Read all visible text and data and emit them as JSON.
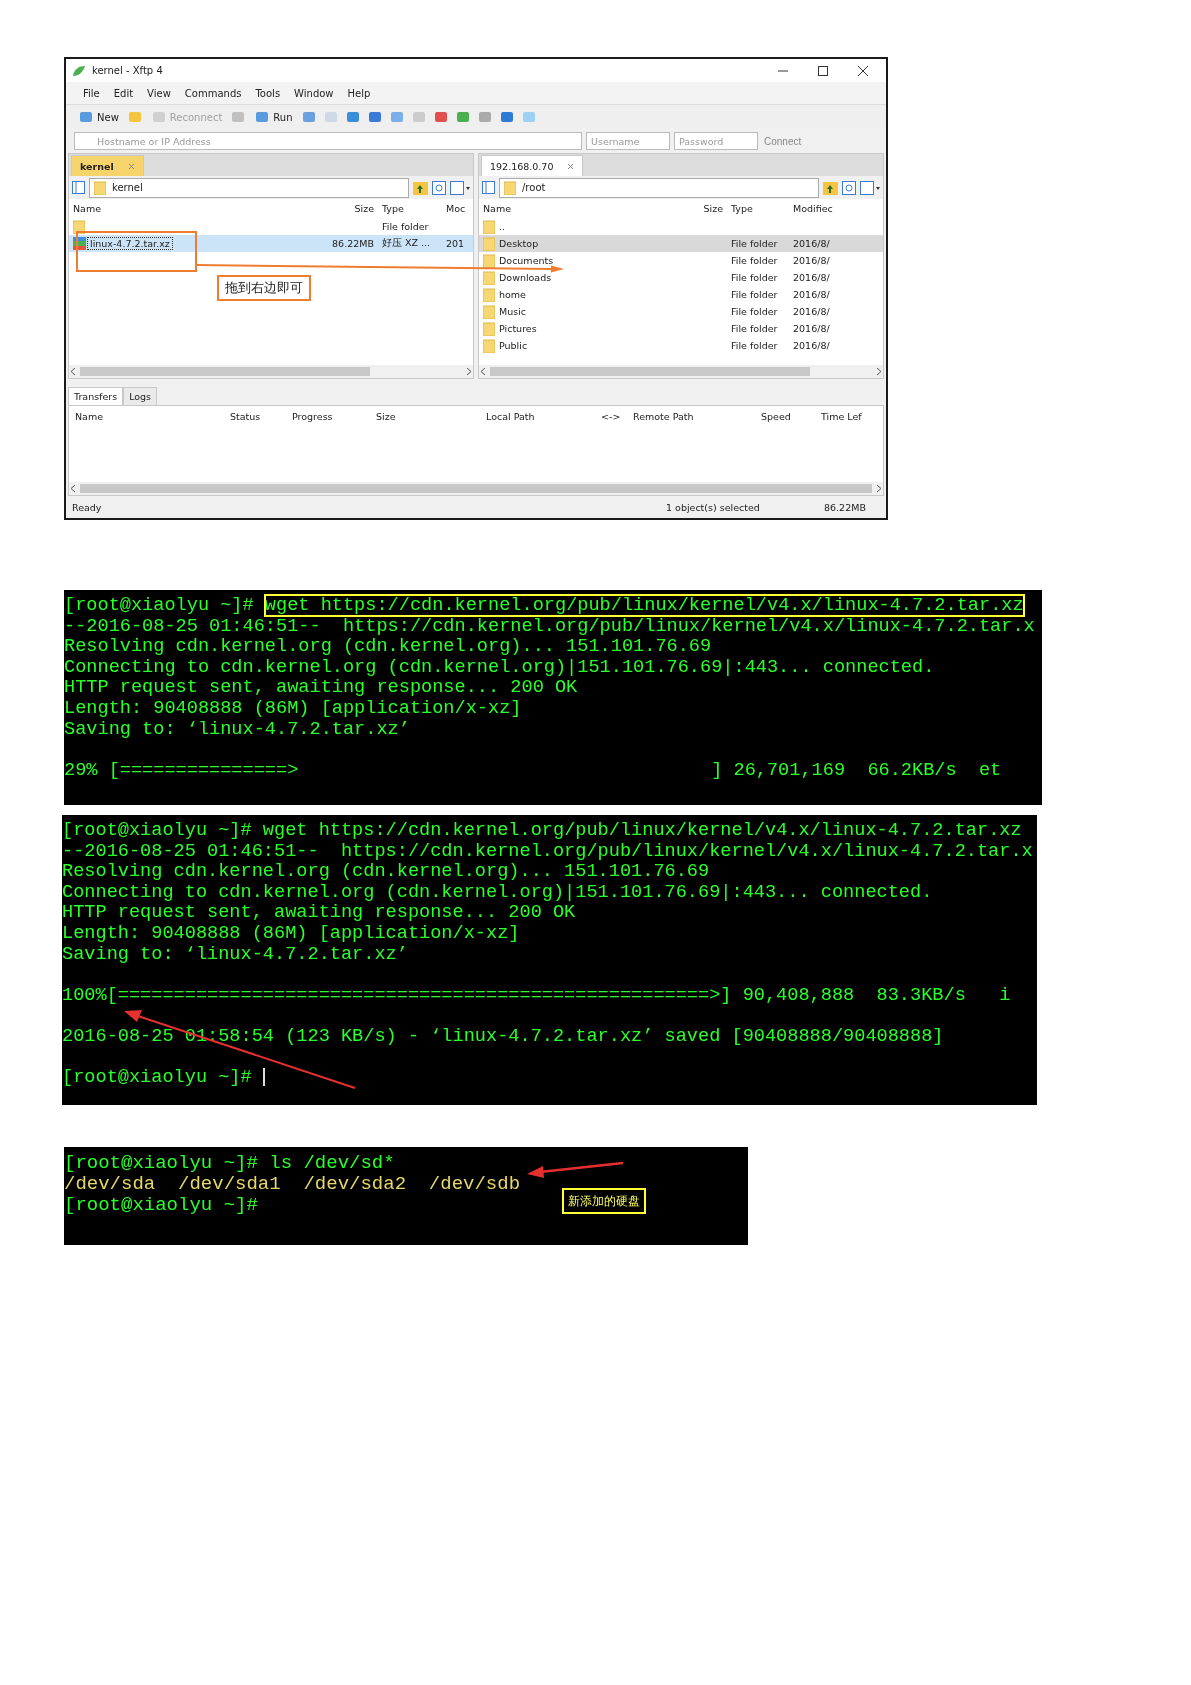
{
  "xftp": {
    "title": "kernel - Xftp 4",
    "menu": [
      "File",
      "Edit",
      "View",
      "Commands",
      "Tools",
      "Window",
      "Help"
    ],
    "toolbar": [
      {
        "label": "New",
        "disabled": false
      },
      {
        "label": "Reconnect",
        "disabled": true
      },
      {
        "label": "Run",
        "disabled": false
      }
    ],
    "address": {
      "hostname_placeholder": "Hostname or IP Address",
      "username_placeholder": "Username",
      "password_placeholder": "Password",
      "connect": "Connect"
    },
    "panes": [
      {
        "tab": "kernel",
        "tab_active": true,
        "path": "kernel",
        "columns": [
          "Name",
          "Size",
          "Type",
          "Moc"
        ],
        "rows": [
          {
            "name": "",
            "size": "",
            "type": "File folder",
            "modified": "",
            "kind": "folder",
            "selected": false
          },
          {
            "name": "linux-4.7.2.tar.xz",
            "size": "86.22MB",
            "type": "好压 XZ ...",
            "modified": "201",
            "kind": "archive",
            "selected": true
          }
        ]
      },
      {
        "tab": "192.168.0.70",
        "tab_active": false,
        "path": "/root",
        "columns": [
          "Name",
          "Size",
          "Type",
          "Modifiec"
        ],
        "rows": [
          {
            "name": "..",
            "size": "",
            "type": "",
            "modified": "",
            "kind": "folder",
            "selected": false
          },
          {
            "name": "Desktop",
            "size": "",
            "type": "File folder",
            "modified": "2016/8/",
            "kind": "folder",
            "selected": true
          },
          {
            "name": "Documents",
            "size": "",
            "type": "File folder",
            "modified": "2016/8/",
            "kind": "folder",
            "selected": false
          },
          {
            "name": "Downloads",
            "size": "",
            "type": "File folder",
            "modified": "2016/8/",
            "kind": "folder",
            "selected": false
          },
          {
            "name": "home",
            "size": "",
            "type": "File folder",
            "modified": "2016/8/",
            "kind": "folder",
            "selected": false
          },
          {
            "name": "Music",
            "size": "",
            "type": "File folder",
            "modified": "2016/8/",
            "kind": "folder",
            "selected": false
          },
          {
            "name": "Pictures",
            "size": "",
            "type": "File folder",
            "modified": "2016/8/",
            "kind": "folder",
            "selected": false
          },
          {
            "name": "Public",
            "size": "",
            "type": "File folder",
            "modified": "2016/8/",
            "kind": "folder",
            "selected": false
          }
        ]
      }
    ],
    "transfers": {
      "tabs": [
        {
          "label": "Transfers",
          "selected": true
        },
        {
          "label": "Logs",
          "selected": false
        }
      ],
      "columns": [
        "Name",
        "Status",
        "Progress",
        "Size",
        "Local Path",
        "<->",
        "Remote Path",
        "Speed",
        "Time Lef"
      ]
    },
    "status_bar": {
      "text": "Ready",
      "selection": "1 object(s) selected",
      "size": "86.22MB"
    },
    "drag_note": "拖到右边即可"
  },
  "terminals": [
    {
      "lines": [
        {
          "kind": "command",
          "prompt": "[root@xiaolyu ~]# ",
          "text": "wget https://cdn.kernel.org/pub/linux/kernel/v4.x/linux-4.7.2.tar.xz",
          "highlighted": true
        },
        {
          "kind": "output",
          "text": "--2016-08-25 01:46:51--  https://cdn.kernel.org/pub/linux/kernel/v4.x/linux-4.7.2.tar.x"
        },
        {
          "kind": "output",
          "text": "Resolving cdn.kernel.org (cdn.kernel.org)... 151.101.76.69"
        },
        {
          "kind": "output",
          "text": "Connecting to cdn.kernel.org (cdn.kernel.org)|151.101.76.69|:443... connected."
        },
        {
          "kind": "output",
          "text": "HTTP request sent, awaiting response... 200 OK"
        },
        {
          "kind": "output",
          "text": "Length: 90408888 (86M) [application/x-xz]"
        },
        {
          "kind": "output",
          "text": "Saving to: ‘linux-4.7.2.tar.xz’"
        },
        {
          "kind": "blank"
        },
        {
          "kind": "output",
          "text": "29% [===============>                                     ] 26,701,169  66.2KB/s  et"
        }
      ]
    },
    {
      "lines": [
        {
          "kind": "command",
          "prompt": "[root@xiaolyu ~]# ",
          "text": "wget https://cdn.kernel.org/pub/linux/kernel/v4.x/linux-4.7.2.tar.xz",
          "highlighted": false
        },
        {
          "kind": "output",
          "text": "--2016-08-25 01:46:51--  https://cdn.kernel.org/pub/linux/kernel/v4.x/linux-4.7.2.tar.x"
        },
        {
          "kind": "output",
          "text": "Resolving cdn.kernel.org (cdn.kernel.org)... 151.101.76.69"
        },
        {
          "kind": "output",
          "text": "Connecting to cdn.kernel.org (cdn.kernel.org)|151.101.76.69|:443... connected."
        },
        {
          "kind": "output",
          "text": "HTTP request sent, awaiting response... 200 OK"
        },
        {
          "kind": "output",
          "text": "Length: 90408888 (86M) [application/x-xz]"
        },
        {
          "kind": "output",
          "text": "Saving to: ‘linux-4.7.2.tar.xz’"
        },
        {
          "kind": "blank"
        },
        {
          "kind": "output",
          "text": "100%[=====================================================>] 90,408,888  83.3KB/s   i"
        },
        {
          "kind": "blank"
        },
        {
          "kind": "output",
          "text": "2016-08-25 01:58:54 (123 KB/s) - ‘linux-4.7.2.tar.xz’ saved [90408888/90408888]"
        },
        {
          "kind": "blank"
        },
        {
          "kind": "prompt",
          "prompt": "[root@xiaolyu ~]# ",
          "cursor": true
        }
      ]
    },
    {
      "note": "新添加的硬盘",
      "lines": [
        {
          "kind": "command",
          "prompt": "[root@xiaolyu ~]# ",
          "text": "ls /dev/sd*",
          "highlighted": false
        },
        {
          "kind": "listing",
          "text": "/dev/sda  /dev/sda1  /dev/sda2  /dev/sdb"
        },
        {
          "kind": "prompt",
          "prompt": "[root@xiaolyu ~]#",
          "cursor": false
        }
      ]
    }
  ]
}
